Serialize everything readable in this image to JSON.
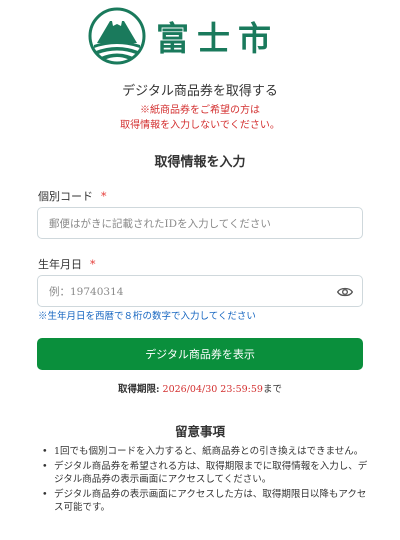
{
  "brand": {
    "name": "富士市",
    "logo_icon": "fuji-city-emblem-icon",
    "primary_color": "#1a7a5c"
  },
  "header": {
    "title": "デジタル商品券を取得する",
    "note_line1": "※紙商品券をご希望の方は",
    "note_line2": "取得情報を入力しないでください。"
  },
  "form": {
    "section_title": "取得情報を入力",
    "code": {
      "label": "個別コード",
      "required_mark": "*",
      "placeholder": "郵便はがきに記載されたIDを入力してください"
    },
    "birthdate": {
      "label": "生年月日",
      "required_mark": "*",
      "placeholder": "例：19740314",
      "toggle_icon": "eye-icon",
      "hint": "※生年月日を西暦で８桁の数字で入力してください"
    },
    "submit_label": "デジタル商品券を表示",
    "submit_color": "#0a8f3c"
  },
  "deadline": {
    "label": "取得期限:",
    "date": "2026/04/30 23:59:59",
    "suffix": "まで"
  },
  "notes": {
    "title": "留意事項",
    "items": [
      "1回でも個別コードを入力すると、紙商品券との引き換えはできません。",
      "デジタル商品券を希望される方は、取得期限までに取得情報を入力し、デジタル商品券の表示画面にアクセスしてください。",
      "デジタル商品券の表示画面にアクセスした方は、取得期限日以降もアクセス可能です。"
    ]
  }
}
